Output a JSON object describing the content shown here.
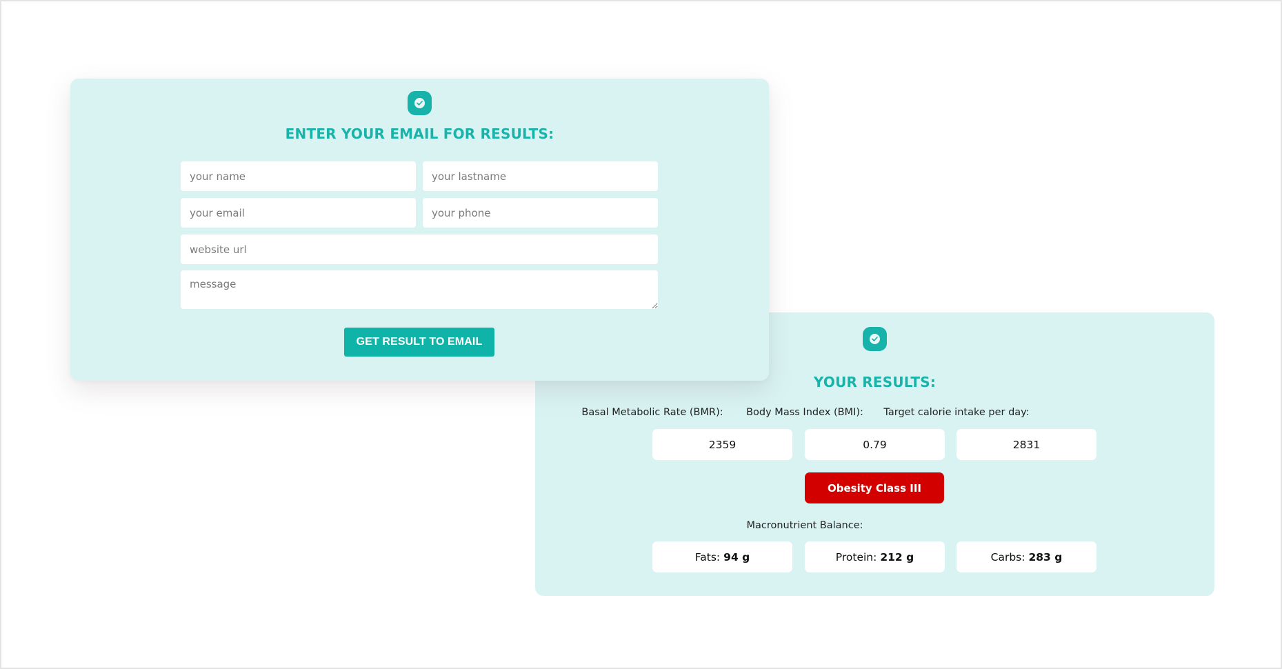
{
  "email_form": {
    "icon": "check-circle-icon",
    "title": "ENTER YOUR EMAIL FOR RESULTS:",
    "fields": {
      "name": {
        "value": "",
        "placeholder": "your name"
      },
      "lastname": {
        "value": "",
        "placeholder": "your lastname"
      },
      "email": {
        "value": "",
        "placeholder": "your email"
      },
      "phone": {
        "value": "",
        "placeholder": "your phone"
      },
      "website": {
        "value": "",
        "placeholder": "website url"
      },
      "message": {
        "value": "",
        "placeholder": "message"
      }
    },
    "submit_label": "GET RESULT TO EMAIL"
  },
  "results": {
    "icon": "check-circle-icon",
    "title": "YOUR RESULTS:",
    "metrics": [
      {
        "label": "Basal Metabolic Rate (BMR):",
        "value": "2359"
      },
      {
        "label": "Body Mass Index (BMI):",
        "value": "0.79"
      },
      {
        "label": "Target calorie intake per day:",
        "value": "2831"
      }
    ],
    "classification": "Obesity Class III",
    "macro_title": "Macronutrient Balance:",
    "macros": [
      {
        "label": "Fats:",
        "value": "94 g"
      },
      {
        "label": "Protein:",
        "value": "212 g"
      },
      {
        "label": "Carbs:",
        "value": "283 g"
      }
    ]
  },
  "colors": {
    "accent": "#17b2a9",
    "panel_background": "#d9f3f3",
    "status_red": "#d30000"
  }
}
